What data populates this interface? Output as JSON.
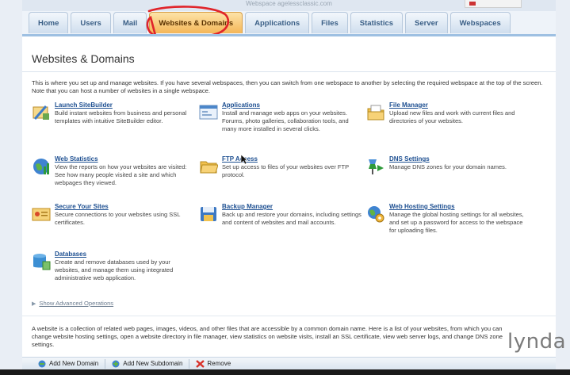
{
  "header": {
    "webspace_label": "Webspace agelessclassic.com"
  },
  "tabs": [
    {
      "label": "Home"
    },
    {
      "label": "Users"
    },
    {
      "label": "Mail"
    },
    {
      "label": "Websites & Domains"
    },
    {
      "label": "Applications"
    },
    {
      "label": "Files"
    },
    {
      "label": "Statistics"
    },
    {
      "label": "Server"
    },
    {
      "label": "Webspaces"
    }
  ],
  "page": {
    "title": "Websites & Domains",
    "intro": "This is where you set up and manage websites. If you have several webspaces, then you can switch from one webspace to another by selecting the required webspace at the top of the screen. Note that you can host a number of websites in a single webspace."
  },
  "tools": [
    {
      "name": "Launch SiteBuilder",
      "desc": "Build instant websites from business and personal templates with intuitive SiteBuilder editor.",
      "icon": "sitebuilder-icon"
    },
    {
      "name": "Applications",
      "desc": "Install and manage web apps on your websites. Forums, photo galleries, collaboration tools, and many more installed in several clicks.",
      "icon": "applications-icon"
    },
    {
      "name": "File Manager",
      "desc": "Upload new files and work with current files and directories of your websites.",
      "icon": "file-manager-icon"
    },
    {
      "name": "Web Statistics",
      "desc": "View the reports on how your websites are visited: See how many people visited a site and which webpages they viewed.",
      "icon": "web-statistics-icon"
    },
    {
      "name": "FTP Access",
      "desc": "Set up access to files of your websites over FTP protocol.",
      "icon": "ftp-folder-icon"
    },
    {
      "name": "DNS Settings",
      "desc": "Manage DNS zones for your domain names.",
      "icon": "dns-icon"
    },
    {
      "name": "Secure Your Sites",
      "desc": "Secure connections to your websites using SSL certificates.",
      "icon": "ssl-certificate-icon"
    },
    {
      "name": "Backup Manager",
      "desc": "Back up and restore your domains, including settings and content of websites and mail accounts.",
      "icon": "backup-icon"
    },
    {
      "name": "Web Hosting Settings",
      "desc": "Manage the global hosting settings for all websites, and set up a password for access to the webspace for uploading files.",
      "icon": "hosting-settings-icon"
    },
    {
      "name": "Databases",
      "desc": "Create and remove databases used by your websites, and manage them using integrated administrative web application.",
      "icon": "databases-icon"
    }
  ],
  "advanced": {
    "label": "Show Advanced Operations"
  },
  "footer": {
    "text": "A website is a collection of related web pages, images, videos, and other files that are accessible by a common domain name. Here is a list of your websites, from which you can change website hosting settings, open a website directory in file manager, view statistics on website visits, install an SSL certificate, view web server logs, and change DNS zone settings."
  },
  "actions": [
    {
      "label": "Add New Domain"
    },
    {
      "label": "Add New Subdomain"
    },
    {
      "label": "Remove"
    }
  ],
  "watermark": "lynda",
  "colors": {
    "active_tab": "#f4b658",
    "link": "#1d4f91",
    "annotation": "#e0242a"
  }
}
